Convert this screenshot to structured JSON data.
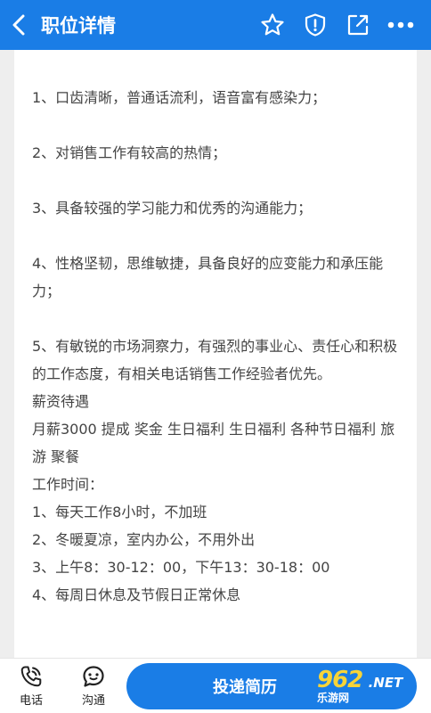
{
  "header": {
    "title": "职位详情",
    "icons": [
      "back-icon",
      "star-icon",
      "report-icon",
      "share-icon",
      "more-icon"
    ]
  },
  "content": {
    "items": [
      "1、口齿清晰，普通话流利，语音富有感染力；",
      "2、对销售工作有较高的热情；",
      "3、具备较强的学习能力和优秀的沟通能力；",
      "4、性格坚韧，思维敏捷，具备良好的应变能力和承压能力；",
      "5、有敏锐的市场洞察力，有强烈的事业心、责任心和积极的工作态度，有相关电话销售工作经验者优先。"
    ],
    "salary_heading": "薪资待遇",
    "salary_text": "月薪3000 提成 奖金 生日福利 生日福利 各种节日福利 旅游 聚餐",
    "time_heading": "工作时间：",
    "time_items": [
      "1、每天工作8小时，不加班",
      "2、冬暖夏凉，室内办公，不用外出",
      "3、上午8：30-12：00，下午13：30-18：00",
      "4、每周日休息及节假日正常休息"
    ]
  },
  "footer": {
    "phone_label": "电话",
    "chat_label": "沟通",
    "apply_label": "投递简历",
    "watermark_num": "962",
    "watermark_net": ".NET",
    "watermark_site": "乐游网"
  },
  "colors": {
    "primary": "#1a7de6",
    "watermark": "#f7d438"
  }
}
